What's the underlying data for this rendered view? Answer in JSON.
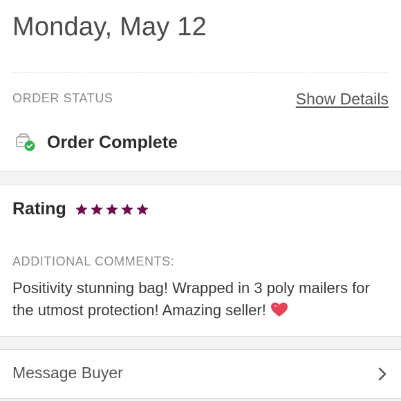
{
  "header": {
    "date": "Monday, May 12"
  },
  "order": {
    "status_label": "ORDER STATUS",
    "show_details": "Show Details",
    "status_text": "Order Complete",
    "status_icon": "package-check-icon"
  },
  "rating": {
    "label": "Rating",
    "stars": 5,
    "max_stars": 5,
    "star_color": "#6d0f4c"
  },
  "comments": {
    "label": "ADDITIONAL COMMENTS:",
    "text": "Positivity stunning bag! Wrapped in 3 poly mailers for the utmost protection! Amazing seller!",
    "emoji": "heart-icon"
  },
  "actions": {
    "message_buyer": "Message Buyer"
  },
  "colors": {
    "check_green": "#2eb24a",
    "heart_red": "#e8425b"
  }
}
